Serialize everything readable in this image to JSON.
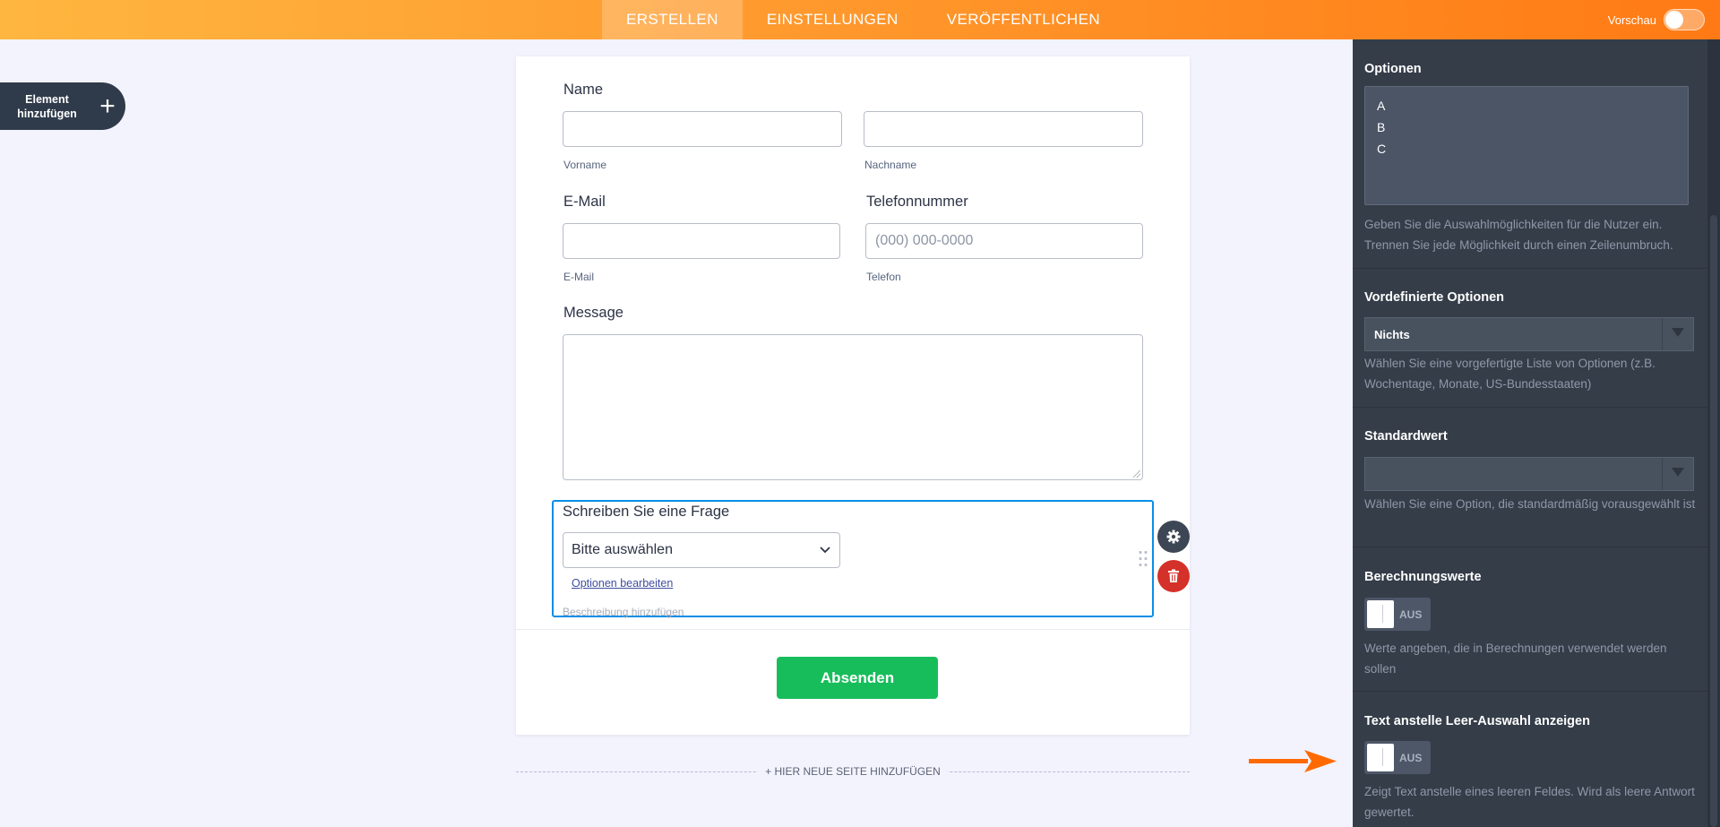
{
  "tabs": [
    "ERSTELLEN",
    "EINSTELLUNGEN",
    "VERÖFFENTLICHEN"
  ],
  "preview_label": "Vorschau",
  "add_element": {
    "line1": "Element",
    "line2": "hinzufügen",
    "icon": "plus-icon"
  },
  "form": {
    "name_label": "Name",
    "first_sub": "Vorname",
    "last_sub": "Nachname",
    "email_label": "E-Mail",
    "email_sub": "E-Mail",
    "phone_label": "Telefonnummer",
    "phone_placeholder": "(000) 000-0000",
    "phone_sub": "Telefon",
    "message_label": "Message",
    "question_label": "Schreiben Sie eine Frage",
    "select_value": "Bitte auswählen",
    "edit_options": "Optionen bearbeiten",
    "add_description": "Beschreibung hinzufügen",
    "submit_label": "Absenden"
  },
  "new_page": "+ HIER NEUE SEITE HINZUFÜGEN",
  "panel": {
    "options_title": "Optionen",
    "options_lines": [
      "A",
      "B",
      "C"
    ],
    "options_desc": "Geben Sie die Auswahlmöglichkeiten für die Nutzer ein. Trennen Sie jede Möglichkeit durch einen Zeilenumbruch.",
    "predef_title": "Vordefinierte Optionen",
    "predef_value": "Nichts",
    "predef_desc": "Wählen Sie eine vorgefertigte Liste von Optionen (z.B. Wochentage, Monate, US-Bundesstaaten)",
    "default_title": "Standardwert",
    "default_value": "",
    "default_desc": "Wählen Sie eine Option, die standardmäßig vorausgewählt ist",
    "calc_title": "Berechnungswerte",
    "calc_toggle": "AUS",
    "calc_desc": "Werte angeben, die in Berechnungen verwendet werden sollen",
    "text_title": "Text anstelle Leer-Auswahl anzeigen",
    "text_toggle": "AUS",
    "text_desc": "Zeigt Text anstelle eines leeren Feldes. Wird als leere Antwort gewertet."
  },
  "colors": {
    "brand_orange": "#ff7a14",
    "submit_green": "#18bd5b",
    "delete_red": "#d4312a",
    "focus_blue": "#0a8ee6"
  }
}
